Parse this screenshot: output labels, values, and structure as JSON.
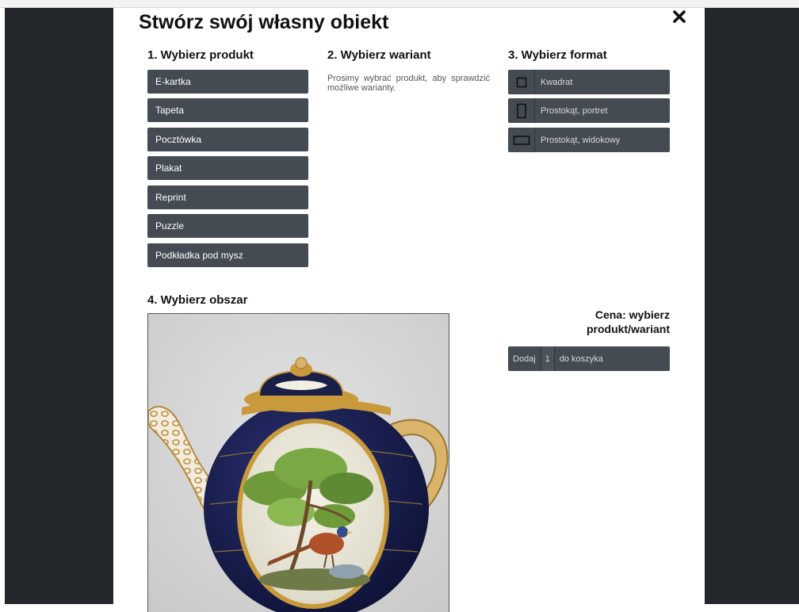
{
  "modal": {
    "title": "Stwórz swój własny obiekt",
    "close_glyph": "✖"
  },
  "step1": {
    "heading": "1. Wybierz produkt",
    "products": [
      "E-kartka",
      "Tapeta",
      "Pocztówka",
      "Plakat",
      "Reprint",
      "Puzzle",
      "Podkładka pod mysz"
    ]
  },
  "step2": {
    "heading": "2. Wybierz wariant",
    "message": "Prosimy wybrać produkt, aby sprawdzić możliwe warianty."
  },
  "step3": {
    "heading": "3. Wybierz format",
    "formats": [
      {
        "label": "Kwadrat",
        "icon": "square-format-icon"
      },
      {
        "label": "Prostokąt, portret",
        "icon": "portrait-format-icon"
      },
      {
        "label": "Prostokąt, widokowy",
        "icon": "landscape-format-icon"
      }
    ]
  },
  "step4": {
    "heading": "4. Wybierz obszar",
    "image_subject": "porcelain-teapot-with-pheasant"
  },
  "price": {
    "line1": "Cena: wybierz",
    "line2": "produkt/wariant"
  },
  "cart": {
    "add_label": "Dodaj",
    "quantity": "1",
    "suffix": "do koszyka"
  },
  "colors": {
    "button_bg": "#444b52",
    "side_panels": "#23272b",
    "cobalt": "#1a1f4a",
    "gold": "#c89a3c"
  }
}
